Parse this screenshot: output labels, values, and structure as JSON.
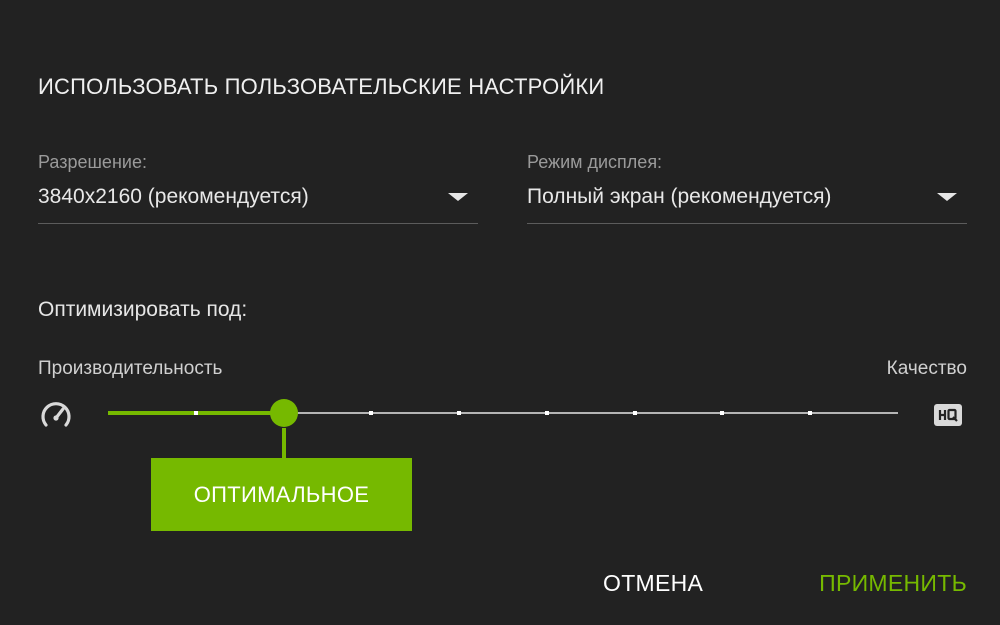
{
  "dialog": {
    "title": "ИСПОЛЬЗОВАТЬ ПОЛЬЗОВАТЕЛЬСКИЕ НАСТРОЙКИ"
  },
  "resolution": {
    "label": "Разрешение:",
    "value": "3840x2160 (рекомендуется)"
  },
  "display_mode": {
    "label": "Режим дисплея:",
    "value": "Полный экран (рекомендуется)"
  },
  "optimize": {
    "label": "Оптимизировать под:",
    "left_label": "Производительность",
    "right_label": "Качество",
    "steps": 10,
    "selected_index": 2,
    "selected_label": "ОПТИМАЛЬНОЕ",
    "left_icon": "performance-gauge-icon",
    "right_icon": "hq-icon"
  },
  "buttons": {
    "cancel": "ОТМЕНА",
    "apply": "ПРИМЕНИТЬ"
  },
  "colors": {
    "accent": "#76b900",
    "background": "#222222"
  }
}
